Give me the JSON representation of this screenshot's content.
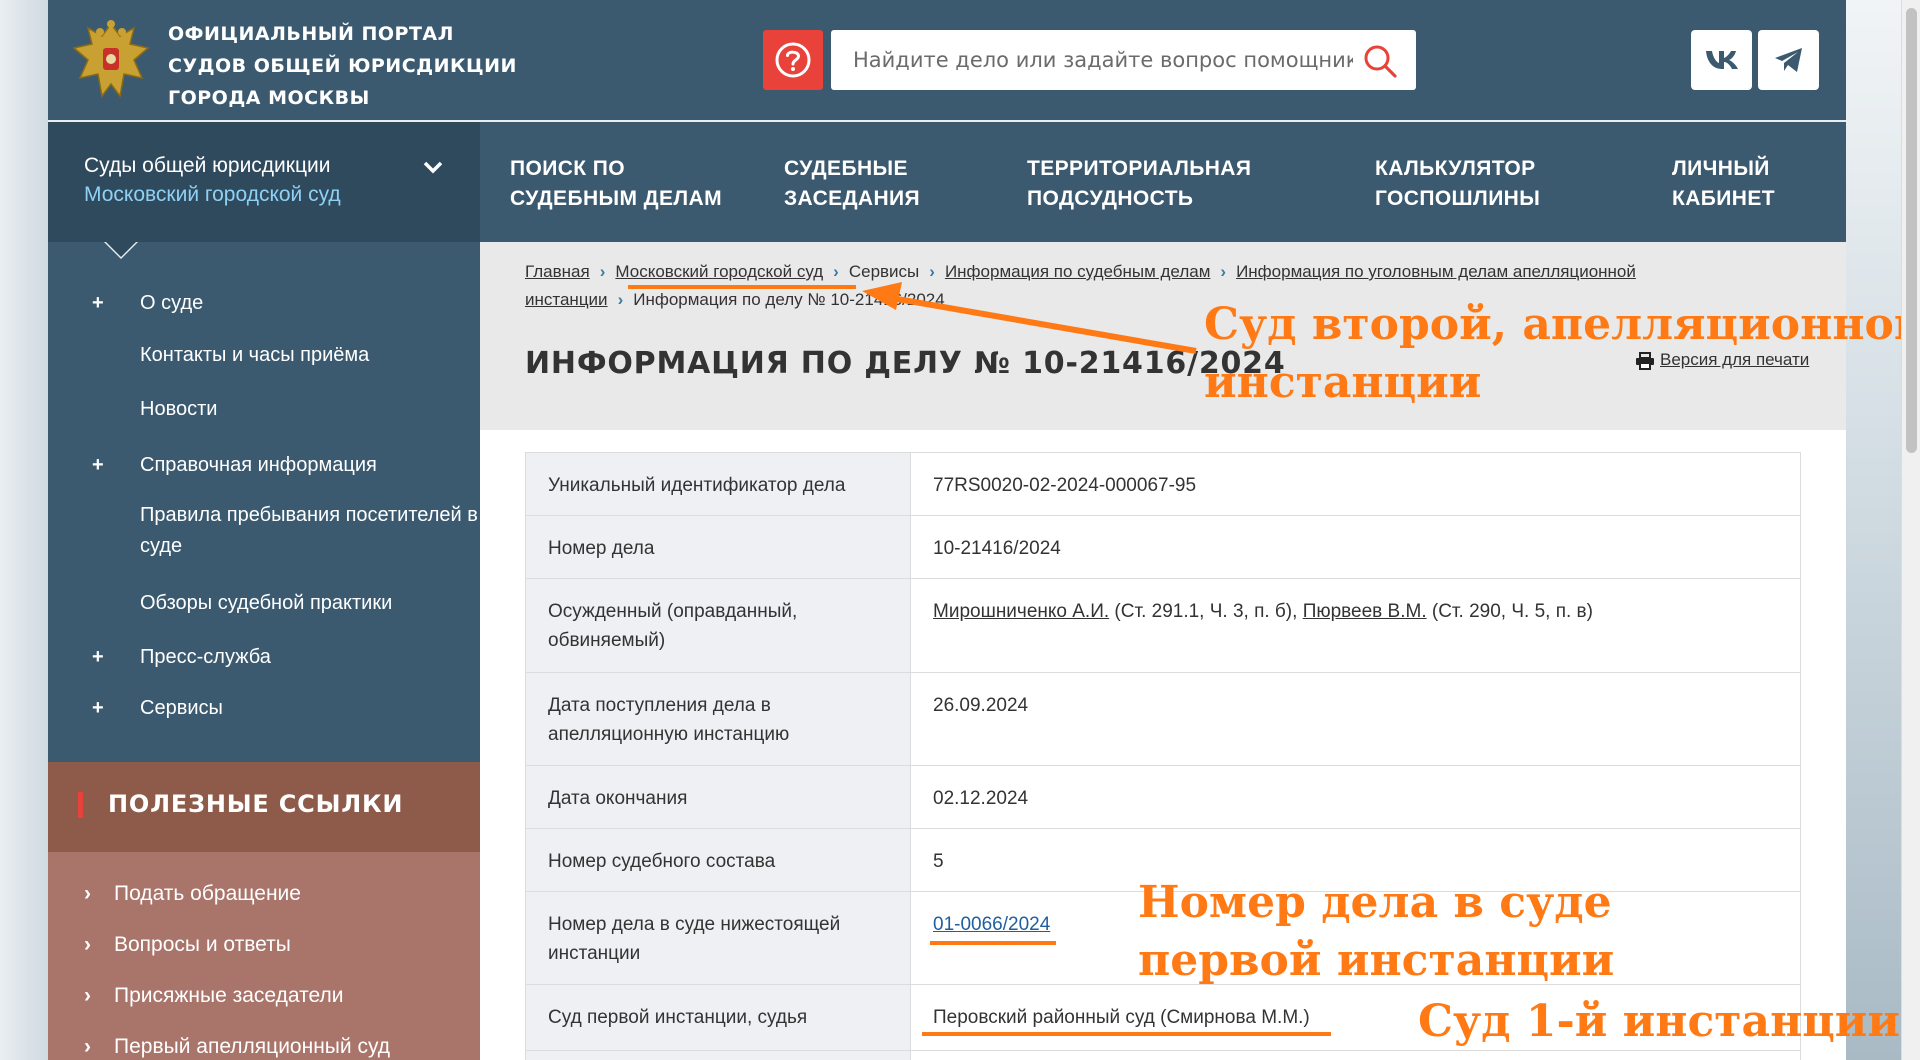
{
  "header": {
    "portal_title": [
      "Официальный портал",
      "судов общей юрисдикции",
      "города Москвы"
    ],
    "search_placeholder": "Найдите дело или задайте вопрос помощнику"
  },
  "nav": {
    "court_select_title": "Суды общей юрисдикции",
    "court_select_value": "Московский городской суд",
    "items": [
      [
        "Поиск по",
        "судебным делам"
      ],
      [
        "Судебные",
        "заседания"
      ],
      [
        "Территориальная",
        "подсудность"
      ],
      [
        "Калькулятор",
        "госпошлины"
      ],
      [
        "Личный",
        "кабинет"
      ]
    ]
  },
  "sidebar": {
    "items": [
      {
        "plus": "+",
        "label": "О суде"
      },
      {
        "plus": "",
        "label": "Контакты и часы приёма"
      },
      {
        "plus": "",
        "label": "Новости"
      },
      {
        "plus": "+",
        "label": "Справочная информация"
      },
      {
        "plus": "",
        "label": "Правила пребывания посетителей в суде"
      },
      {
        "plus": "",
        "label": "Обзоры судебной практики"
      },
      {
        "plus": "+",
        "label": "Пресс-служба"
      },
      {
        "plus": "+",
        "label": "Сервисы"
      }
    ]
  },
  "useful_links": {
    "title": "Полезные ссылки",
    "arrow": "›",
    "items": [
      "Подать обращение",
      "Вопросы и ответы",
      "Присяжные заседатели",
      "Первый апелляционный суд"
    ]
  },
  "breadcrumbs": {
    "home": "Главная",
    "court": "Московский городской суд",
    "services": "Сервисы",
    "info": "Информация по судебным делам",
    "criminal_line1": "Информация по уголовным делам апелляционной",
    "criminal_line2": "инстанции",
    "current": "Информация по делу № 10-21416/2024",
    "sep": "›"
  },
  "page": {
    "title": "Информация по делу № 10-21416/2024",
    "print_label": "Версия для печати"
  },
  "case_info": {
    "rows": {
      "uid_label": "Уникальный идентификатор дела",
      "uid_value": "77RS0020-02-2024-000067-95",
      "number_label": "Номер дела",
      "number_value": "10-21416/2024",
      "convicted_label": "Осужденный (оправданный, обвиняемый)",
      "convicted_1_name": "Мирошниченко А.И.",
      "convicted_1_art": " (Ст. 291.1, Ч. 3, п. б), ",
      "convicted_2_name": "Пюрвеев В.М.",
      "convicted_2_art": " (Ст. 290, Ч. 5, п. в)",
      "received_label": "Дата поступления дела в апелляционную инстанцию",
      "received_value": "26.09.2024",
      "end_label": "Дата окончания",
      "end_value": "02.12.2024",
      "panel_label": "Номер судебного состава",
      "panel_value": "5",
      "lower_num_label": "Номер дела в суде нижестоящей инстанции",
      "lower_num_value": "01-0066/2024",
      "first_court_label": "Суд первой инстанции, судья",
      "first_court_value": "Перовский районный суд (Смирнова М.М.)"
    }
  },
  "annotations": {
    "appeal_court": [
      "Суд второй, апелляционной",
      "инстанции"
    ],
    "first_case_no": [
      "Номер дела в суде",
      "первой инстанции"
    ],
    "first_court": "Суд 1-й инстанции"
  },
  "colors": {
    "header_bg": "#3b5a70",
    "accent_red": "#e8423a",
    "annotation_orange": "#ff7a14",
    "useful_bg": "#8e5a4a"
  }
}
